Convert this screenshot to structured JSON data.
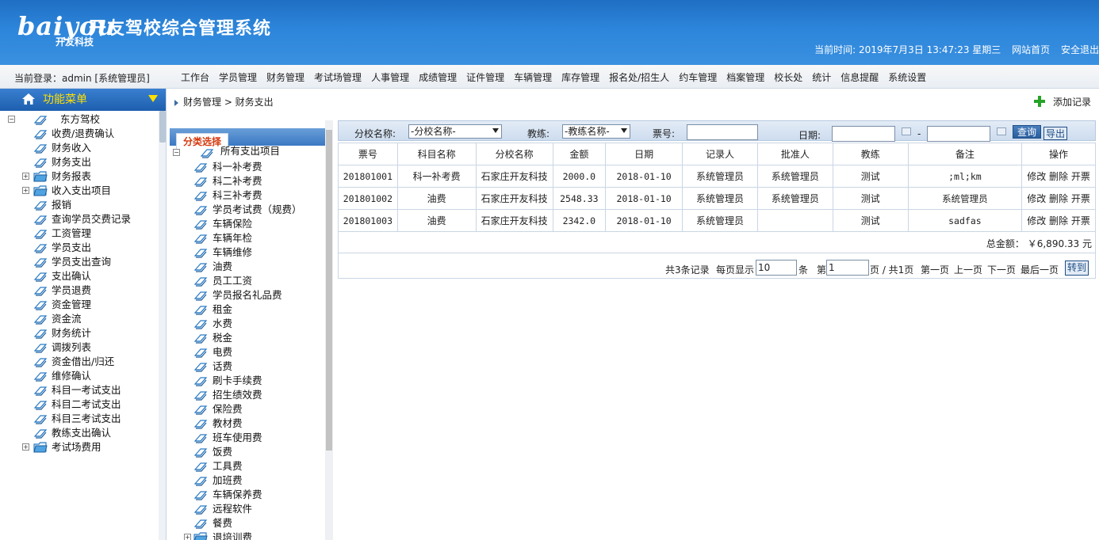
{
  "header": {
    "logo_text": "baiyou",
    "logo_sub": "开友科技",
    "title": "开友驾校综合管理系统",
    "current_time": "当前时间: 2019年7月3日 13:47:23 星期三",
    "home_link": "网站首页",
    "logout_link": "安全退出"
  },
  "topbar": {
    "login_info": "当前登录：admin  [系统管理员]",
    "menu": [
      "工作台",
      "学员管理",
      "财务管理",
      "考试场管理",
      "人事管理",
      "成绩管理",
      "证件管理",
      "车辆管理",
      "库存管理",
      "报名处/招生人",
      "约车管理",
      "档案管理",
      "校长处",
      "统计",
      "信息提醒",
      "系统设置"
    ]
  },
  "sidebar": {
    "title": "功能菜单",
    "root": "东方驾校",
    "items": [
      "收费/退费确认",
      "财务收入",
      "财务支出",
      "财务报表",
      "收入支出项目",
      "报销",
      "查询学员交费记录",
      "工资管理",
      "学员支出",
      "学员支出查询",
      "支出确认",
      "学员退费",
      "资金管理",
      "资金流",
      "财务统计",
      "调拨列表",
      "资金借出/归还",
      "维修确认",
      "科目一考试支出",
      "科目二考试支出",
      "科目三考试支出",
      "教练支出确认",
      "考试场费用"
    ]
  },
  "breadcrumb": "财务管理 > 财务支出",
  "add_record_label": "添加记录",
  "category": {
    "tab_label": "分类选择",
    "root": "所有支出项目",
    "items": [
      "科一补考费",
      "科二补考费",
      "科三补考费",
      "学员考试费（规费）",
      "车辆保险",
      "车辆年检",
      "车辆维修",
      "油费",
      "员工工资",
      "学员报名礼品费",
      "租金",
      "水费",
      "税金",
      "电费",
      "话费",
      "刷卡手续费",
      "招生绩效费",
      "保险费",
      "教材费",
      "班车使用费",
      "饭费",
      "工具费",
      "加班费",
      "车辆保养费",
      "远程软件",
      "餐费",
      "退培训费"
    ]
  },
  "filters": {
    "branch_label": "分校名称:",
    "branch_value": "-分校名称-",
    "coach_label": "教练:",
    "coach_value": "-教练名称-",
    "ticket_label": "票号:",
    "date_label": "日期:",
    "date_sep": "-",
    "query_btn": "查询",
    "export_btn": "导出"
  },
  "table": {
    "columns": [
      "票号",
      "科目名称",
      "分校名称",
      "金额",
      "日期",
      "记录人",
      "批准人",
      "教练",
      "备注",
      "操作"
    ],
    "rows": [
      {
        "ticket": "201801001",
        "subject": "科一补考费",
        "branch": "石家庄开友科技",
        "amount": "2000.0",
        "date": "2018-01-10",
        "recorder": "系统管理员",
        "approver": "系统管理员",
        "coach": "测试",
        "note": ";ml;km",
        "ops": "修改 删除 开票"
      },
      {
        "ticket": "201801002",
        "subject": "油费",
        "branch": "石家庄开友科技",
        "amount": "2548.33",
        "date": "2018-01-10",
        "recorder": "系统管理员",
        "approver": "系统管理员",
        "coach": "测试",
        "note": "系统管理员",
        "ops": "修改 删除 开票"
      },
      {
        "ticket": "201801003",
        "subject": "油费",
        "branch": "石家庄开友科技",
        "amount": "2342.0",
        "date": "2018-01-10",
        "recorder": "系统管理员",
        "approver": "",
        "coach": "测试",
        "note": "sadfas",
        "ops": "修改 删除 开票"
      }
    ],
    "total": "总金额： ￥6,890.33 元"
  },
  "pager": {
    "count": "共3条记录",
    "per_page_label": "每页显示",
    "per_page": "10",
    "per_page_unit": "条",
    "page_label": "第",
    "page": "1",
    "page_info": "页 / 共1页",
    "first": "第一页",
    "prev": "上一页",
    "next": "下一页",
    "last": "最后一页",
    "go": "转到"
  },
  "colors": {
    "header_blue": "#2d86db",
    "menu_title_yellow": "#ffe000",
    "tab_red": "#d4380d",
    "add_green": "#27a327"
  }
}
